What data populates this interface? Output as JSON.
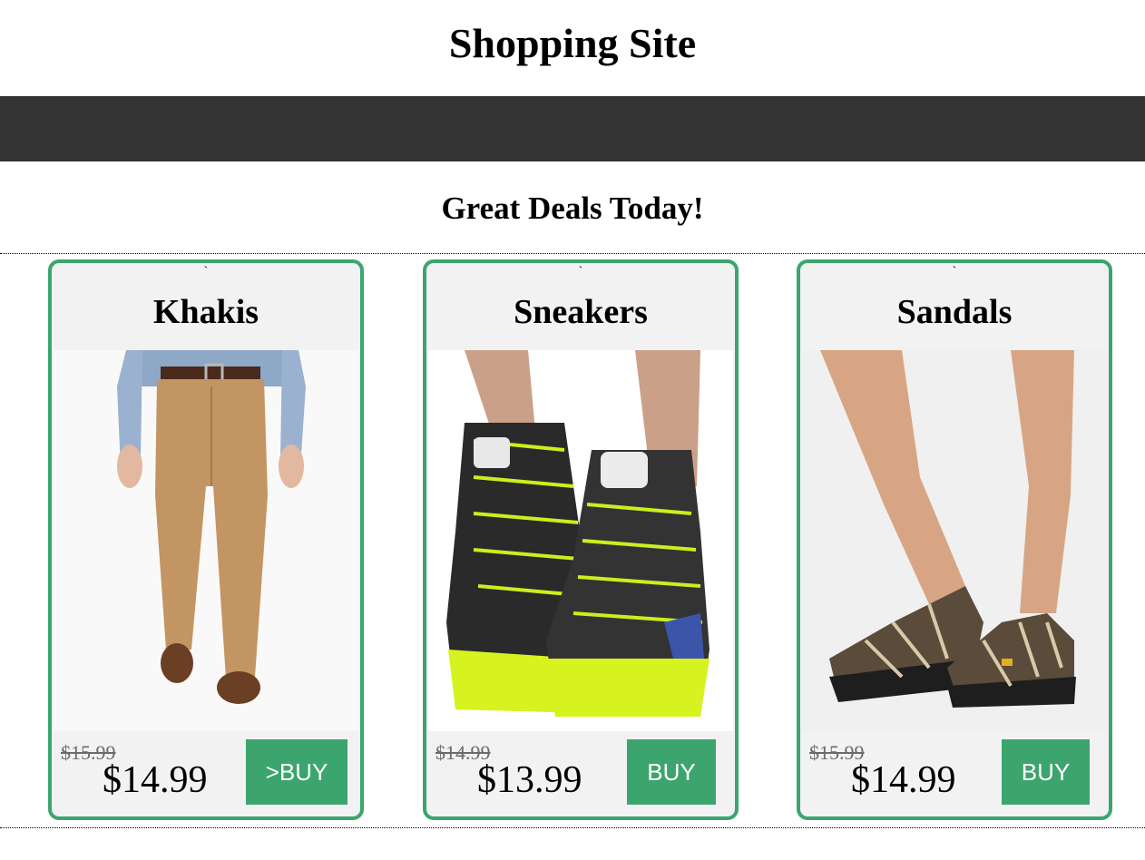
{
  "site": {
    "title": "Shopping Site"
  },
  "section": {
    "title": "Great Deals Today!"
  },
  "products": [
    {
      "tick": "`",
      "name": "Khakis",
      "old_price": "$15.99",
      "price": "$14.99",
      "buy_label": ">BUY",
      "image_icon": "khaki-pants-photo"
    },
    {
      "tick": "`",
      "name": "Sneakers",
      "old_price": "$14.99",
      "price": "$13.99",
      "buy_label": "BUY",
      "image_icon": "sneakers-photo"
    },
    {
      "tick": "`",
      "name": "Sandals",
      "old_price": "$15.99",
      "price": "$14.99",
      "buy_label": "BUY",
      "image_icon": "sandals-photo"
    }
  ],
  "colors": {
    "accent": "#3ca56e",
    "navbar": "#333333",
    "card_bg": "#f2f2f2"
  }
}
